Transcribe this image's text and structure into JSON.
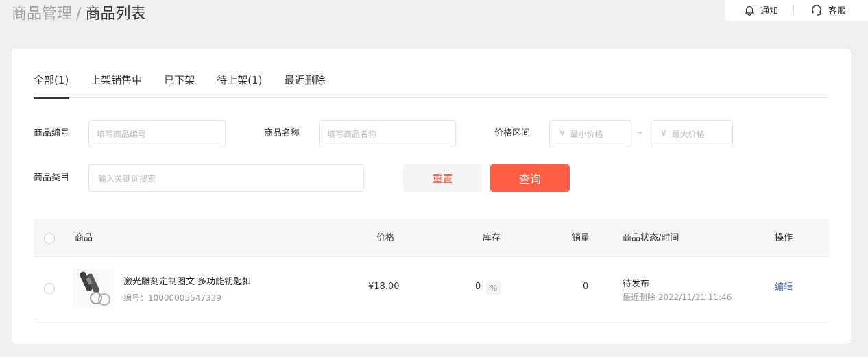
{
  "breadcrumb": {
    "parent": "商品管理",
    "separator": "/",
    "current": "商品列表"
  },
  "topbar": {
    "notice": "通知",
    "service": "客服"
  },
  "tabs": [
    {
      "label": "全部(1)",
      "active": true
    },
    {
      "label": "上架销售中",
      "active": false
    },
    {
      "label": "已下架",
      "active": false
    },
    {
      "label": "待上架(1)",
      "active": false
    },
    {
      "label": "最近删除",
      "active": false
    }
  ],
  "filters": {
    "code_label": "商品编号",
    "code_placeholder": "填写商品编号",
    "name_label": "商品名称",
    "name_placeholder": "填写商品名称",
    "price_label": "价格区间",
    "currency_symbol": "¥",
    "min_price_placeholder": "最小价格",
    "max_price_placeholder": "最大价格",
    "range_separator": "–",
    "category_label": "商品类目",
    "category_placeholder": "输入关键词搜索",
    "reset_label": "重置",
    "query_label": "查询"
  },
  "table": {
    "headers": {
      "product": "商品",
      "price": "价格",
      "stock": "库存",
      "sales": "销量",
      "status": "商品状态/时间",
      "action": "操作"
    },
    "rows": [
      {
        "name": "激光雕刻定制图文 多功能钥匙扣",
        "sku": "编号：10000005547339",
        "price": "¥18.00",
        "stock": "0",
        "stock_edit_icon": "%",
        "sales": "0",
        "status": "待发布",
        "status_time": "最近删除 2022/11/21 11:46",
        "action": "编辑"
      }
    ]
  },
  "colors": {
    "accent": "#ff5e45",
    "link": "#4a6bb0"
  }
}
